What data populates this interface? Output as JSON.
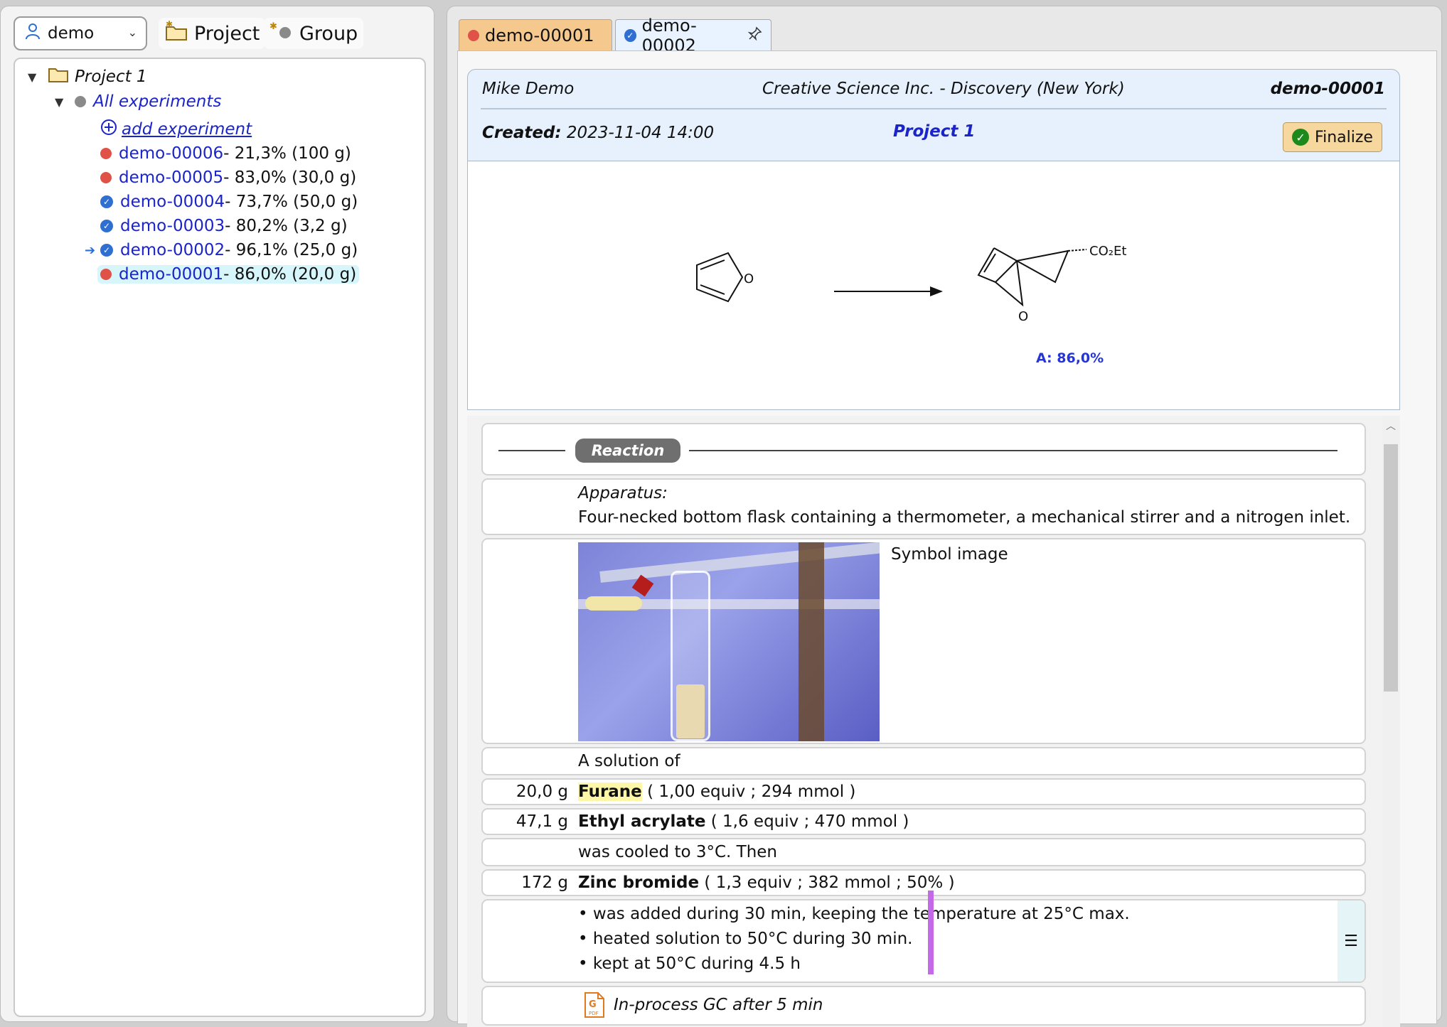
{
  "user_menu": {
    "user": "demo"
  },
  "toolbar": {
    "project_label": "Project",
    "group_label": "Group"
  },
  "tree": {
    "project": "Project 1",
    "all_experiments": "All experiments",
    "add_experiment": "add experiment",
    "experiments": [
      {
        "id": "demo-00006",
        "info": " - 21,3% (100 g)",
        "status": "open",
        "current": false,
        "selected": false
      },
      {
        "id": "demo-00005",
        "info": " - 83,0% (30,0 g)",
        "status": "open",
        "current": false,
        "selected": false
      },
      {
        "id": "demo-00004",
        "info": " - 73,7% (50,0 g)",
        "status": "finalized",
        "current": false,
        "selected": false
      },
      {
        "id": "demo-00003",
        "info": " - 80,2% (3,2 g)",
        "status": "finalized",
        "current": false,
        "selected": false
      },
      {
        "id": "demo-00002",
        "info": " - 96,1% (25,0 g)",
        "status": "finalized",
        "current": true,
        "selected": false
      },
      {
        "id": "demo-00001",
        "info": " - 86,0% (20,0 g)",
        "status": "open",
        "current": false,
        "selected": true
      }
    ]
  },
  "tabs": [
    {
      "label": "demo-00001",
      "status": "open",
      "active": true
    },
    {
      "label": "demo-00002",
      "status": "finalized",
      "active": false
    }
  ],
  "header": {
    "author": "Mike Demo",
    "organization": "Creative Science Inc. - Discovery (New York)",
    "experiment_id": "demo-00001",
    "created_label": "Created:",
    "created_value": " 2023-11-04 14:00",
    "project": "Project 1",
    "finalize_label": "Finalize"
  },
  "scheme": {
    "reactant_atom": "O",
    "product_atom": "O",
    "product_group": "CO₂Et",
    "yield_label": "A: 86,0%"
  },
  "procedure": {
    "section_title": "Reaction",
    "apparatus_label": "Apparatus:",
    "apparatus_text": "Four-necked bottom flask containing a thermometer, a mechanical stirrer and a nitrogen inlet.",
    "image_caption": "Symbol image",
    "solution_text": "A solution of",
    "reagents": [
      {
        "amount": "20,0 g",
        "name": "Furane",
        "details": " ( 1,00 equiv ; 294 mmol )"
      },
      {
        "amount": "47,1 g",
        "name": "Ethyl acrylate",
        "details": " ( 1,6 equiv ; 470 mmol )"
      }
    ],
    "cooled_text": "was cooled to 3°C. Then",
    "catalyst": {
      "amount": "172 g",
      "name": "Zinc bromide",
      "details": " ( 1,3 equiv ; 382 mmol ; 50% )"
    },
    "steps": [
      "was added during 30 min, keeping the temperature at 25°C max.",
      "heated solution to 50°C during 30 min.",
      "kept at 50°C during 4.5 h"
    ],
    "attachment": "In-process GC after 5 min"
  },
  "colors": {
    "open_status": "#e05248",
    "finalized_status": "#2e6fd1",
    "link": "#1a24c8",
    "header_bg": "#e6f1fd",
    "finalize_bg": "#f6d79e",
    "highlight": "#fff7a8",
    "marker": "#c46ae6"
  }
}
